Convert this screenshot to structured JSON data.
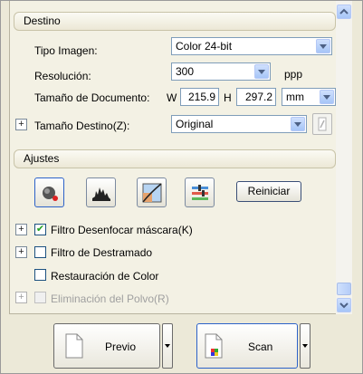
{
  "destino": {
    "header": "Destino",
    "tipo_imagen_label": "Tipo Imagen:",
    "tipo_imagen_value": "Color 24-bit",
    "resolucion_label": "Resolución:",
    "resolucion_value": "300",
    "resolucion_unit": "ppp",
    "tamano_doc_label": "Tamaño de Documento:",
    "w_label": "W",
    "w_value": "215.9",
    "h_label": "H",
    "h_value": "297.2",
    "unit_value": "mm",
    "tamano_destino_label": "Tamaño Destino(Z):",
    "tamano_destino_value": "Original"
  },
  "ajustes": {
    "header": "Ajustes",
    "reiniciar_label": "Reiniciar",
    "tools": [
      "auto-exposure-icon",
      "histogram-icon",
      "tone-curve-icon",
      "color-palette-icon"
    ],
    "options": [
      {
        "label": "Filtro Desenfocar máscara(K)",
        "checked": true,
        "expandable": true,
        "enabled": true
      },
      {
        "label": "Filtro de Destramado",
        "checked": false,
        "expandable": true,
        "enabled": true
      },
      {
        "label": "Restauración de Color",
        "checked": false,
        "expandable": false,
        "enabled": true
      },
      {
        "label": "Eliminación del Polvo(R)",
        "checked": false,
        "expandable": true,
        "enabled": false
      }
    ]
  },
  "footer": {
    "previo_label": "Previo",
    "scan_label": "Scan"
  },
  "colors": {
    "panel_bg": "#ece9d8",
    "scroll_bg": "#f3f1e4",
    "border_blue": "#7f9db9"
  }
}
